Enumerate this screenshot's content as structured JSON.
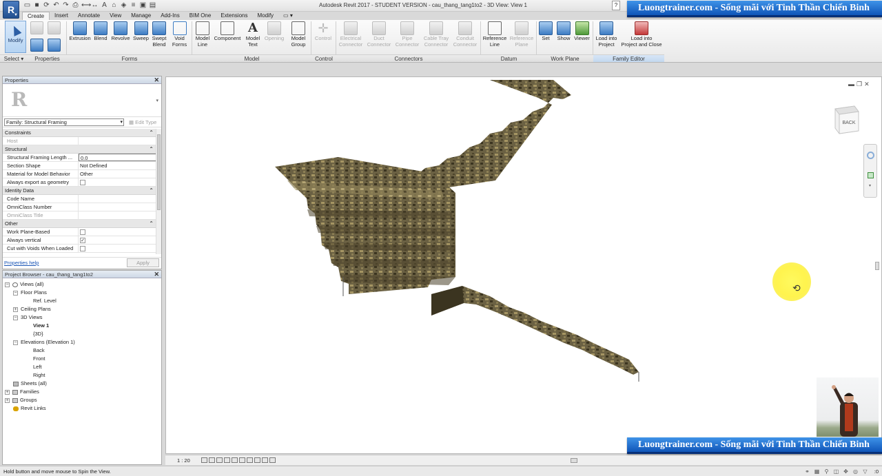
{
  "window": {
    "app_letter": "R",
    "title": "Autodesk Revit 2017 - STUDENT VERSION -   cau_thang_tang1to2 - 3D View: View 1"
  },
  "tabs": [
    "Create",
    "Insert",
    "Annotate",
    "View",
    "Manage",
    "Add-Ins",
    "BIM One",
    "Extensions",
    "Modify"
  ],
  "ribbon": {
    "modify_label": "Modify",
    "select_label": "Select",
    "panels": [
      "Properties",
      "Forms",
      "Model",
      "Control",
      "Connectors",
      "Datum",
      "Work Plane",
      "Family Editor"
    ],
    "tools": [
      {
        "id": "extrusion",
        "label": "Extrusion"
      },
      {
        "id": "blend",
        "label": "Blend"
      },
      {
        "id": "revolve",
        "label": "Revolve"
      },
      {
        "id": "sweep",
        "label": "Sweep"
      },
      {
        "id": "swept-blend",
        "label": "Swept\nBlend"
      },
      {
        "id": "void-forms",
        "label": "Void\nForms"
      },
      {
        "id": "model-line",
        "label": "Model\nLine"
      },
      {
        "id": "component",
        "label": "Component"
      },
      {
        "id": "model-text",
        "label": "Model\nText"
      },
      {
        "id": "opening",
        "label": "Opening"
      },
      {
        "id": "model-group",
        "label": "Model\nGroup"
      },
      {
        "id": "control",
        "label": "Control"
      },
      {
        "id": "electrical-connector",
        "label": "Electrical\nConnector"
      },
      {
        "id": "duct-connector",
        "label": "Duct\nConnector"
      },
      {
        "id": "pipe-connector",
        "label": "Pipe\nConnector"
      },
      {
        "id": "cable-tray-connector",
        "label": "Cable Tray\nConnector"
      },
      {
        "id": "conduit-connector",
        "label": "Conduit\nConnector"
      },
      {
        "id": "reference-line",
        "label": "Reference\nLine"
      },
      {
        "id": "reference-plane",
        "label": "Reference\nPlane"
      },
      {
        "id": "set",
        "label": "Set"
      },
      {
        "id": "show",
        "label": "Show"
      },
      {
        "id": "viewer",
        "label": "Viewer"
      },
      {
        "id": "load-into-project",
        "label": "Load into\nProject"
      },
      {
        "id": "load-into-project-close",
        "label": "Load into\nProject and Close"
      }
    ]
  },
  "properties": {
    "title": "Properties",
    "family": "Family: Structural Framing",
    "edit_type": "Edit Type",
    "groups": {
      "constraints": "Constraints",
      "structural": "Structural",
      "identity": "Identity Data",
      "other": "Other"
    },
    "rows": {
      "host": "Host",
      "sf_length_label": "Structural Framing Length ...",
      "sf_length_value": "0.0",
      "section_shape_label": "Section Shape",
      "section_shape_value": "Not Defined",
      "material_label": "Material for Model Behavior",
      "material_value": "Other",
      "always_export": "Always export as geometry",
      "code_name": "Code Name",
      "omniclass_number": "OmniClass Number",
      "omniclass_title": "OmniClass Title",
      "work_plane_based": "Work Plane-Based",
      "always_vertical": "Always vertical",
      "cut_with_voids": "Cut with Voids When Loaded"
    },
    "help": "Properties help",
    "apply": "Apply"
  },
  "browser": {
    "title": "Project Browser - cau_thang_tang1to2",
    "views_all": "Views (all)",
    "floor_plans": "Floor Plans",
    "ref_level": "Ref. Level",
    "ceiling_plans": "Ceiling Plans",
    "views_3d": "3D Views",
    "view1": "View 1",
    "view3d": "{3D}",
    "elevations": "Elevations (Elevation 1)",
    "back": "Back",
    "front": "Front",
    "left": "Left",
    "right": "Right",
    "sheets": "Sheets (all)",
    "families": "Families",
    "groups": "Groups",
    "revit_links": "Revit Links"
  },
  "viewport": {
    "viewcube_label": "BACK",
    "scale": "1 : 20"
  },
  "status": {
    "message": "Hold button and move mouse to Spin the View.",
    "filter_count": ":0"
  },
  "watermark": "Luongtrainer.com - Sống mãi với Tinh Thần Chiến Binh",
  "colors": {
    "banner": "#1f6fd1",
    "highlight": "#fff23a",
    "stair_stone": "#6b6143"
  }
}
